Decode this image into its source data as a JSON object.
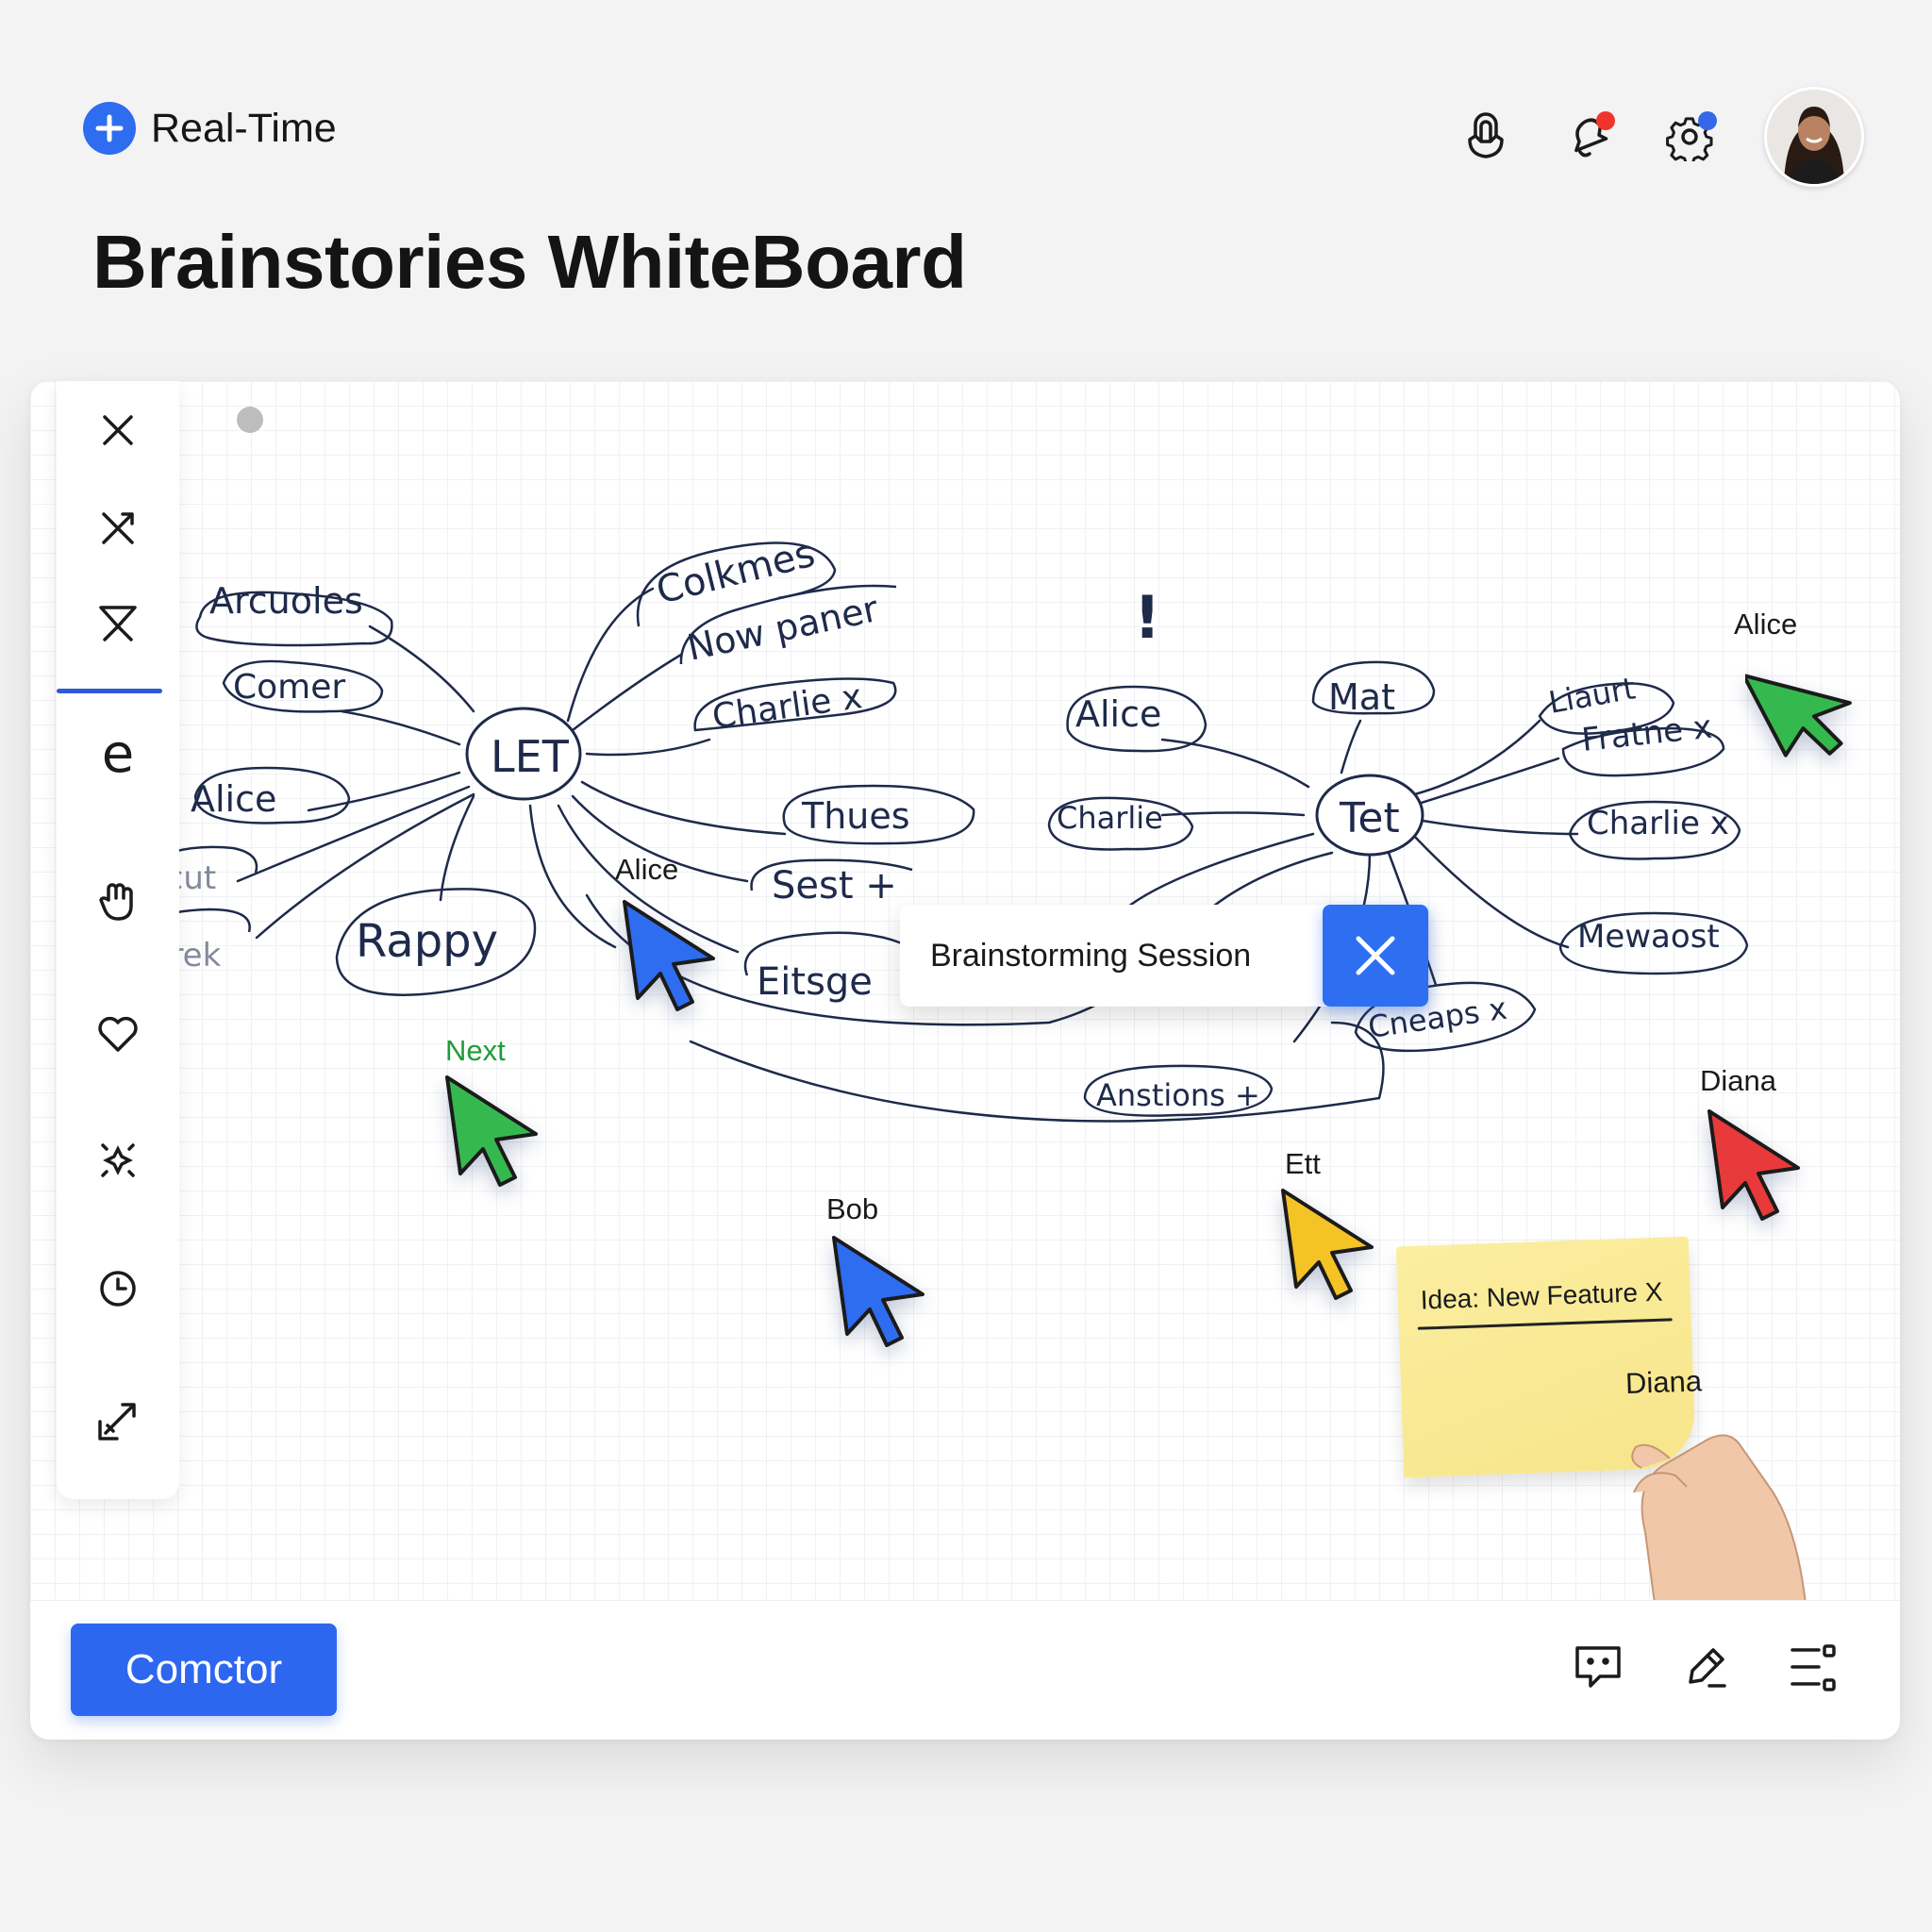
{
  "app": {
    "brand_name": "Real-Time",
    "page_title": "Brainstories WhiteBoard"
  },
  "header": {
    "icons": [
      "gesture-icon",
      "notification-icon",
      "settings-icon",
      "avatar"
    ],
    "notification_dot_color": "#f0342c",
    "settings_dot_color": "#3568e8"
  },
  "toolbar": {
    "tools": [
      "close-icon",
      "shuffle-icon",
      "lasso-icon",
      "text-tool-icon",
      "hand-tool-icon",
      "heart-icon",
      "sparkle-icon",
      "clock-icon",
      "export-icon"
    ],
    "active_tool": "lasso-icon",
    "text_tool_glyph": "e"
  },
  "mindmap": {
    "left_hub": "LET",
    "left_nodes": [
      "Arcuoles",
      "Comer",
      "Alice",
      "Rcut",
      "Flirek",
      "Rappy",
      "Colkmes",
      "Now paner",
      "Charlie x",
      "Thues",
      "Sest +",
      "Eitsge"
    ],
    "right_hub": "Tet",
    "right_nodes": [
      "Alice",
      "Mat",
      "Charlie",
      "Liaurt",
      "Fratne x",
      "Charlie x",
      "Mewaost",
      "Cneaps x",
      "Anstions +"
    ],
    "exclamation": "!"
  },
  "session_card": {
    "label": "Brainstorming Session"
  },
  "cursors": [
    {
      "name": "Alice",
      "color": "#35b94e"
    },
    {
      "name": "Alice",
      "color": "#2e6cf0"
    },
    {
      "name": "Next",
      "color": "#35b94e"
    },
    {
      "name": "Bob",
      "color": "#2e6cf0"
    },
    {
      "name": "Ett",
      "color": "#f4c325"
    },
    {
      "name": "Diana",
      "color": "#e83a3a"
    }
  ],
  "sticky_note": {
    "text": "Idea: New Feature X",
    "author": "Diana",
    "color": "#f7e58a"
  },
  "bottom_bar": {
    "primary_button": "Comctor",
    "icons": [
      "comment-icon",
      "edit-icon",
      "list-settings-icon"
    ],
    "accent": "#2e67ef"
  }
}
